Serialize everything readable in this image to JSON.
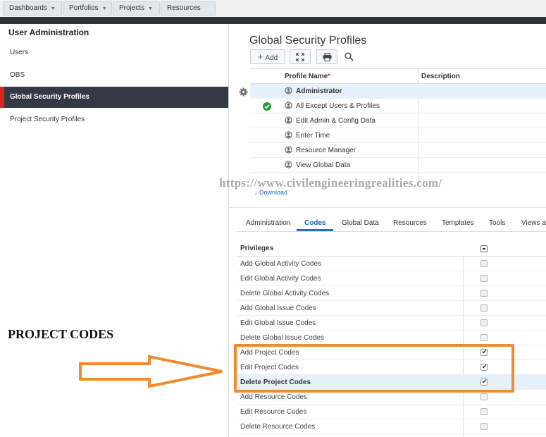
{
  "topnav": {
    "items": [
      {
        "label": "Dashboards",
        "caret": true
      },
      {
        "label": "Portfolios",
        "caret": true
      },
      {
        "label": "Projects",
        "caret": true
      },
      {
        "label": "Resources",
        "caret": false
      }
    ]
  },
  "sidebar": {
    "title": "User Administration",
    "items": [
      {
        "label": "Users",
        "active": false
      },
      {
        "label": "OBS",
        "active": false
      },
      {
        "label": "Global Security Profiles",
        "active": true
      },
      {
        "label": "Project Security Profiles",
        "active": false
      }
    ]
  },
  "main": {
    "title": "Global Security Profiles",
    "toolbar": {
      "add_label": "Add",
      "add_symbol": "+"
    },
    "grid": {
      "columns": [
        "Profile Name",
        "Description"
      ],
      "required_marker": "*",
      "rows": [
        {
          "name": "Administrator",
          "selected": true
        },
        {
          "name": "All Except Users & Profiles",
          "selected": false
        },
        {
          "name": "Edit Admin & Config Data",
          "selected": false
        },
        {
          "name": "Enter Time",
          "selected": false
        },
        {
          "name": "Resource Manager",
          "selected": false
        },
        {
          "name": "View Global Data",
          "selected": false
        }
      ]
    },
    "download_label": "Download"
  },
  "watermark": "https://www.civilengineeringrealities.com/",
  "tabs": [
    {
      "label": "Administration",
      "active": false
    },
    {
      "label": "Codes",
      "active": true
    },
    {
      "label": "Global Data",
      "active": false
    },
    {
      "label": "Resources",
      "active": false
    },
    {
      "label": "Templates",
      "active": false
    },
    {
      "label": "Tools",
      "active": false
    },
    {
      "label": "Views an",
      "active": false
    }
  ],
  "privileges": {
    "header": "Privileges",
    "rows": [
      {
        "label": "Add Global Activity Codes",
        "checked": false,
        "selected": false
      },
      {
        "label": "Edit Global Activity Codes",
        "checked": false,
        "selected": false
      },
      {
        "label": "Delete Global Activity Codes",
        "checked": false,
        "selected": false
      },
      {
        "label": "Add Global Issue Codes",
        "checked": false,
        "selected": false
      },
      {
        "label": "Edit Global Issue Codes",
        "checked": false,
        "selected": false
      },
      {
        "label": "Delete Global Issue Codes",
        "checked": false,
        "selected": false
      },
      {
        "label": "Add Project Codes",
        "checked": true,
        "selected": false
      },
      {
        "label": "Edit Project Codes",
        "checked": true,
        "selected": false
      },
      {
        "label": "Delete Project Codes",
        "checked": true,
        "selected": true
      },
      {
        "label": "Add Resource Codes",
        "checked": false,
        "selected": false
      },
      {
        "label": "Edit Resource Codes",
        "checked": false,
        "selected": false
      },
      {
        "label": "Delete Resource Codes",
        "checked": false,
        "selected": false
      }
    ]
  },
  "annotation": {
    "label": "PROJECT CODES",
    "color": "#f48a2f"
  },
  "colors": {
    "accent": "#2a6eb7",
    "sidebar_active_bg": "#343a45",
    "sidebar_active_marker": "#e0241c",
    "success": "#2e9b3a"
  },
  "icons": [
    "gear-icon",
    "success-check-icon",
    "profile-icon",
    "fullscreen-icon",
    "print-icon",
    "search-icon",
    "download-icon",
    "arrow-right-icon"
  ]
}
